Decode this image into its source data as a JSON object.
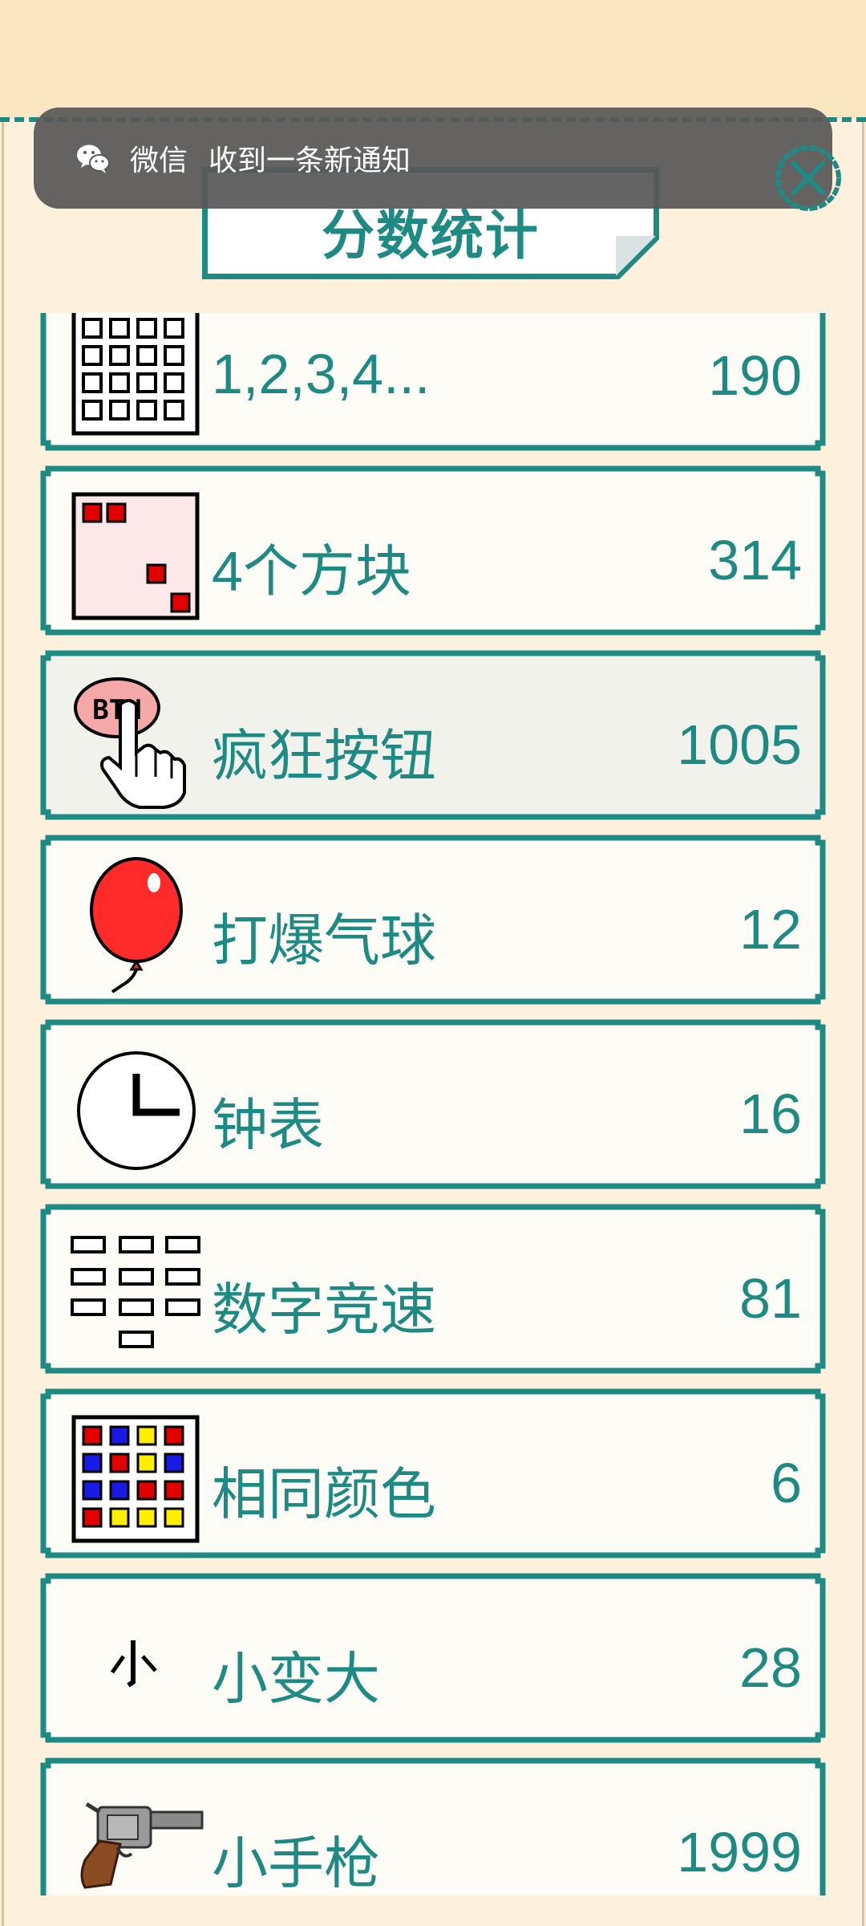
{
  "notification": {
    "app": "微信",
    "message": "收到一条新通知",
    "icon": "wechat-icon"
  },
  "dialog": {
    "title": "分数统计",
    "close_icon": "close-icon"
  },
  "colors": {
    "accent": "#1e8a84",
    "background": "#fdf1de",
    "row_background": "#fdfcf7",
    "row_highlight": "#f2f2ed"
  },
  "scores": [
    {
      "name": "1,2,3,4...",
      "score": "190",
      "icon": "number-grid-icon"
    },
    {
      "name": "4个方块",
      "score": "314",
      "icon": "four-squares-icon"
    },
    {
      "name": "疯狂按钮",
      "score": "1005",
      "icon": "button-press-icon"
    },
    {
      "name": "打爆气球",
      "score": "12",
      "icon": "balloon-icon"
    },
    {
      "name": "钟表",
      "score": "16",
      "icon": "clock-icon"
    },
    {
      "name": "数字竞速",
      "score": "81",
      "icon": "number-race-icon"
    },
    {
      "name": "相同颜色",
      "score": "6",
      "icon": "color-grid-icon"
    },
    {
      "name": "小变大",
      "score": "28",
      "icon": "small-to-big-icon"
    },
    {
      "name": "小手枪",
      "score": "1999",
      "icon": "pistol-icon"
    }
  ]
}
